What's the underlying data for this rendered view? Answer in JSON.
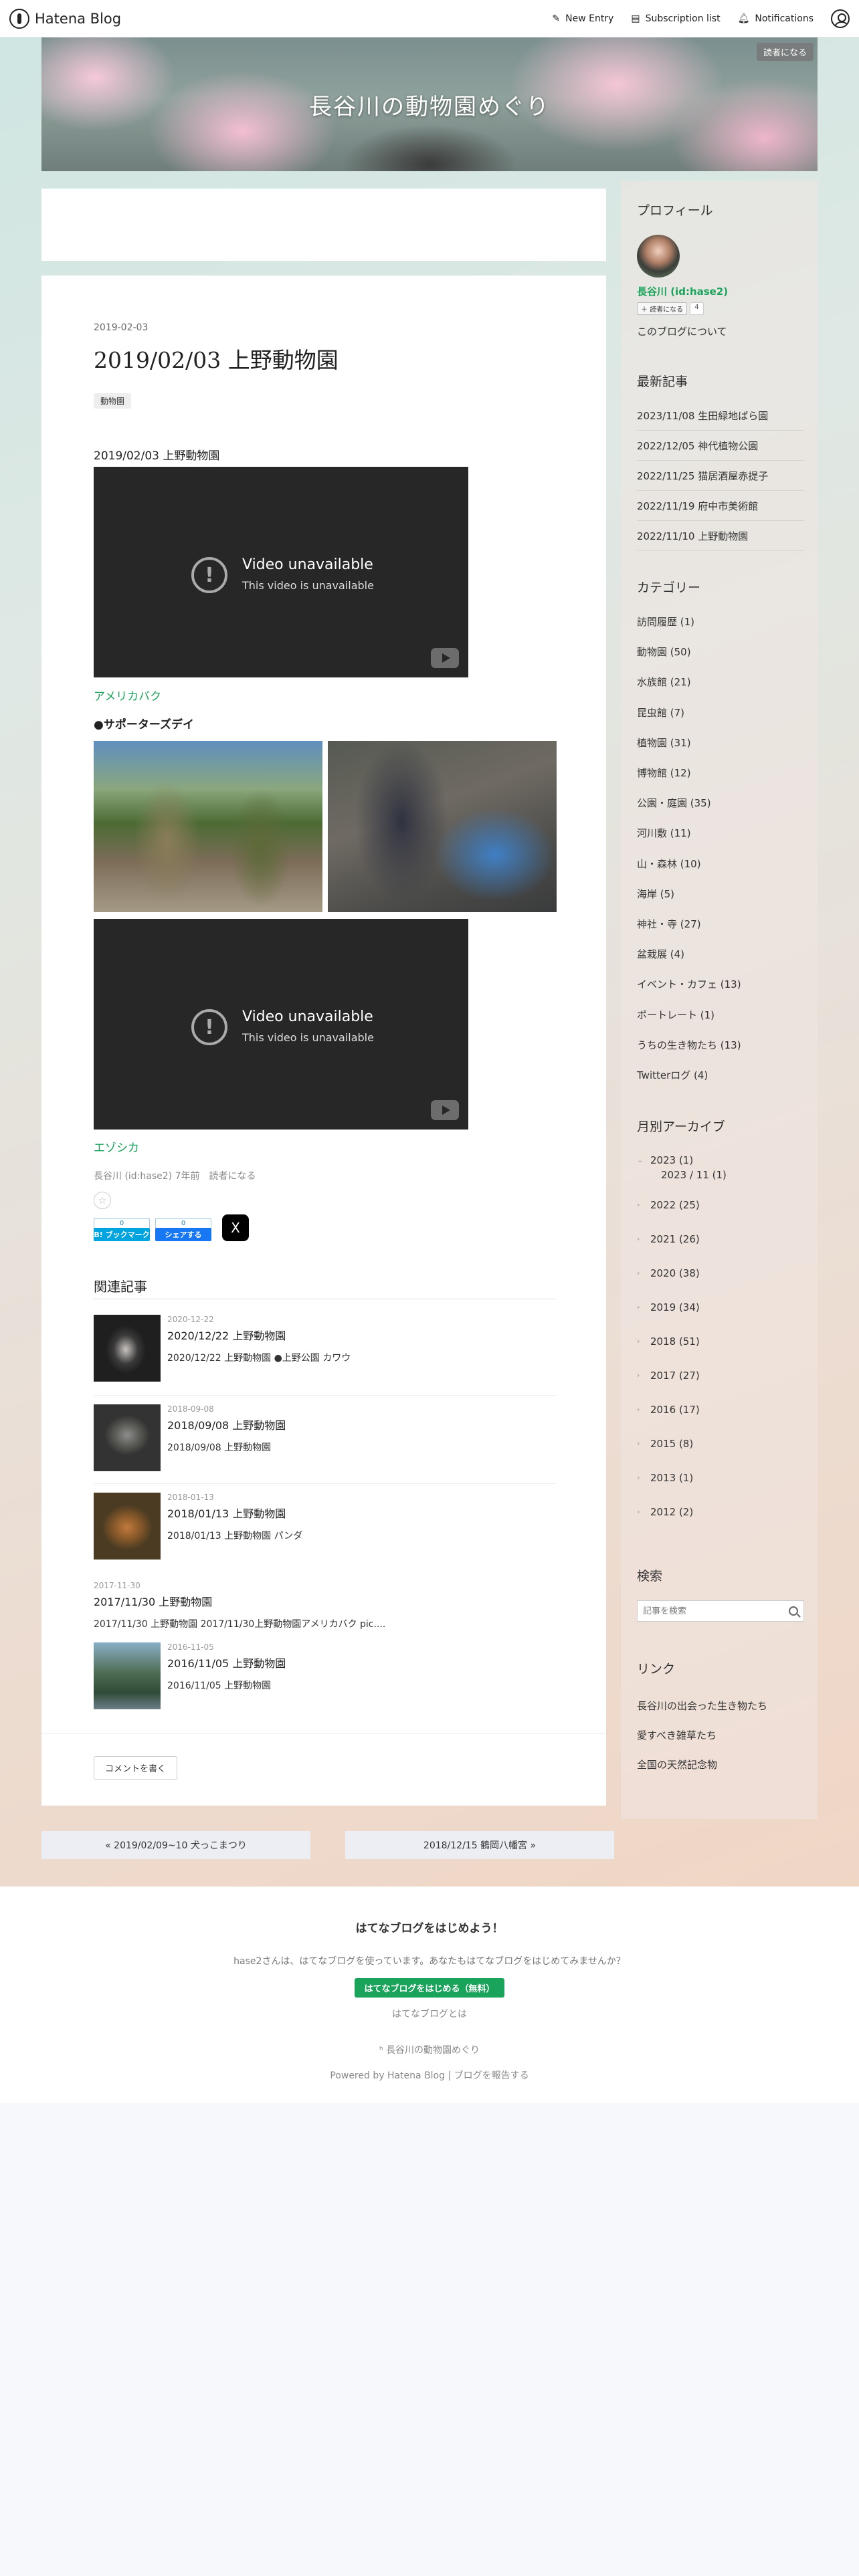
{
  "global_header": {
    "brand": "Hatena Blog",
    "new_entry": "New Entry",
    "subscription_list": "Subscription list",
    "notifications": "Notifications"
  },
  "blog": {
    "title": "長谷川の動物園めぐり",
    "subscribe_badge": "読者になる"
  },
  "entry": {
    "date": "2019-02-03",
    "title": "2019/02/03 上野動物園",
    "category": "動物園",
    "intro": "2019/02/03 上野動物園",
    "video": {
      "title": "Video unavailable",
      "subtitle": "This video is unavailable"
    },
    "link1": "アメリカバク",
    "section_heading": "●サポーターズデイ",
    "link2": "エゾシカ",
    "footer_text": "長谷川 (id:hase2) 7年前　読者になる",
    "share": {
      "hatena_count": "0",
      "hatena_label": "B! ブックマーク",
      "fb_count": "0",
      "fb_label": "シェアする",
      "x_label": "X"
    }
  },
  "related": {
    "heading": "関連記事",
    "items": [
      {
        "date": "2020-12-22",
        "title": "2020/12/22 上野動物園",
        "snippet": "2020/12/22 上野動物園 ●上野公園 カワウ"
      },
      {
        "date": "2018-09-08",
        "title": "2018/09/08 上野動物園",
        "snippet": "2018/09/08 上野動物園"
      },
      {
        "date": "2018-01-13",
        "title": "2018/01/13 上野動物園",
        "snippet": "2018/01/13 上野動物園 パンダ"
      },
      {
        "date": "2017-11-30",
        "title": "2017/11/30 上野動物園",
        "snippet": "2017/11/30 上野動物園 2017/11/30上野動物園アメリカバク pic...."
      },
      {
        "date": "2016-11-05",
        "title": "2016/11/05 上野動物園",
        "snippet": "2016/11/05 上野動物園"
      }
    ]
  },
  "comment_button": "コメントを書く",
  "pager": {
    "prev": "« 2019/02/09~10 犬っこまつり",
    "next": "2018/12/15 鶴岡八幡宮 »"
  },
  "sidebar": {
    "profile": {
      "heading": "プロフィール",
      "name": "長谷川 (id:hase2)",
      "reader_button": "読者になる",
      "reader_count": "4",
      "about": "このブログについて"
    },
    "recent": {
      "heading": "最新記事",
      "items": [
        "2023/11/08 生田緑地ばら園",
        "2022/12/05 神代植物公園",
        "2022/11/25 猫居酒屋赤提子",
        "2022/11/19 府中市美術館",
        "2022/11/10 上野動物園"
      ]
    },
    "categories": {
      "heading": "カテゴリー",
      "items": [
        "訪問履歴 (1)",
        "動物園 (50)",
        "水族館 (21)",
        "昆虫館 (7)",
        "植物園 (31)",
        "博物館 (12)",
        "公園・庭園 (35)",
        "河川敷 (11)",
        "山・森林 (10)",
        "海岸 (5)",
        "神社・寺 (27)",
        "盆栽展 (4)",
        "イベント・カフェ (13)",
        "ポートレート (1)",
        "うちの生き物たち (13)",
        "Twitterログ (4)"
      ]
    },
    "archive": {
      "heading": "月別アーカイブ",
      "first": "2023 (1)",
      "first_sub": "2023 / 11 (1)",
      "years": [
        "2022 (25)",
        "2021 (26)",
        "2020 (38)",
        "2019 (34)",
        "2018 (51)",
        "2017 (27)",
        "2016 (17)",
        "2015 (8)",
        "2013 (1)",
        "2012 (2)"
      ]
    },
    "search": {
      "heading": "検索",
      "placeholder": "記事を検索"
    },
    "links": {
      "heading": "リンク",
      "items": [
        "長谷川の出会った生き物たち",
        "愛すべき雑草たち",
        "全国の天然記念物"
      ]
    }
  },
  "footer": {
    "title": "はてなブログをはじめよう！",
    "text": "hase2さんは、はてなブログを使っています。あなたもはてなブログをはじめてみませんか？",
    "start_button": "はてなブログをはじめる（無料）",
    "about": "はてなブログとは",
    "blog_name": "長谷川の動物園めぐり",
    "powered": "Powered by Hatena Blog | ブログを報告する"
  }
}
